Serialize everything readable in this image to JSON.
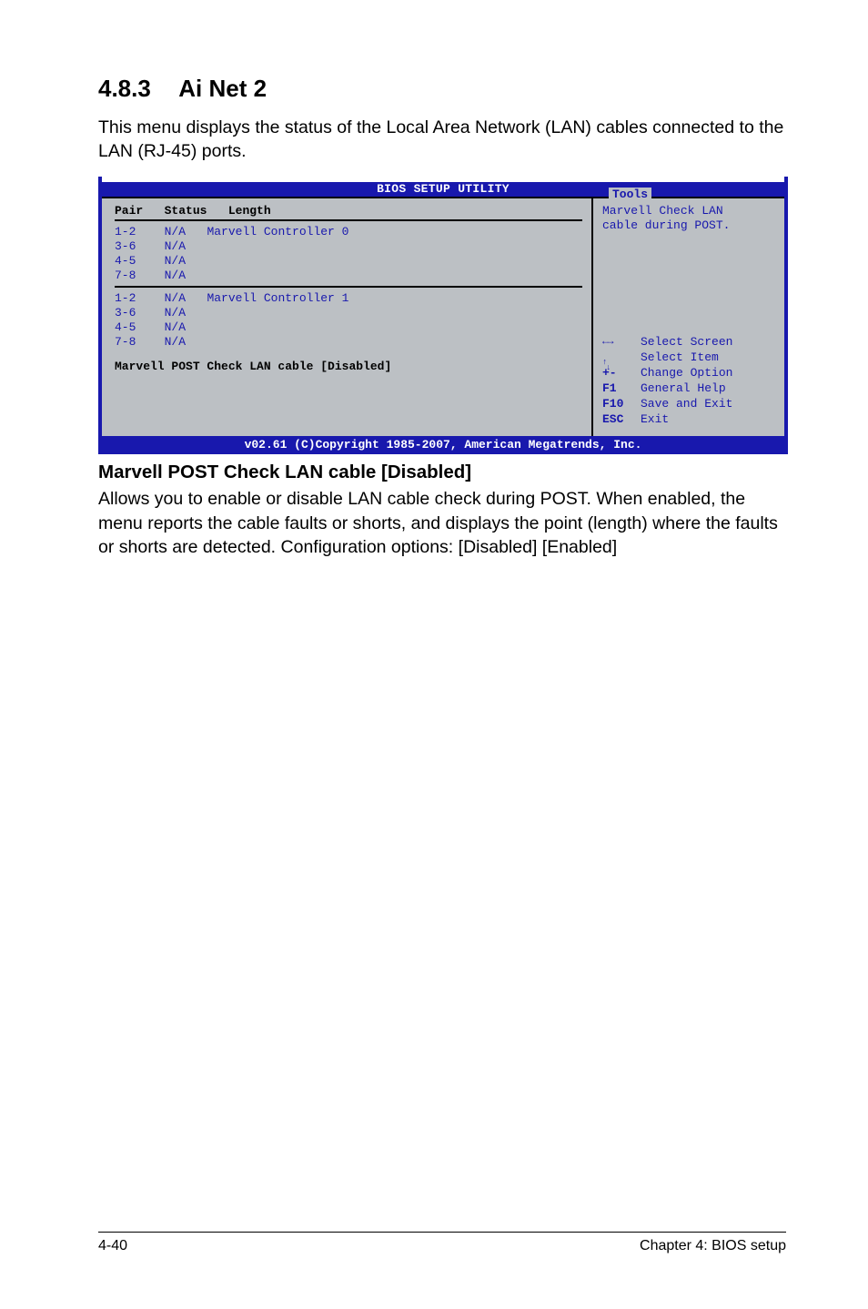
{
  "section": {
    "number": "4.8.3",
    "title": "Ai Net 2"
  },
  "intro": "This menu displays the status of the Local Area Network (LAN) cables connected to the LAN (RJ-45) ports.",
  "bios": {
    "banner": "BIOS SETUP UTILITY",
    "tab": "Tools",
    "header": {
      "pair": "Pair",
      "status": "Status",
      "length": "Length"
    },
    "ctrl0": {
      "name": "Marvell Controller 0",
      "rows": [
        {
          "pair": "1-2",
          "status": "N/A"
        },
        {
          "pair": "3-6",
          "status": "N/A"
        },
        {
          "pair": "4-5",
          "status": "N/A"
        },
        {
          "pair": "7-8",
          "status": "N/A"
        }
      ]
    },
    "ctrl1": {
      "name": "Marvell Controller 1",
      "rows": [
        {
          "pair": "1-2",
          "status": "N/A"
        },
        {
          "pair": "3-6",
          "status": "N/A"
        },
        {
          "pair": "4-5",
          "status": "N/A"
        },
        {
          "pair": "7-8",
          "status": "N/A"
        }
      ]
    },
    "setting": {
      "label": "Marvell POST Check LAN cable",
      "value": "[Disabled]"
    },
    "help": {
      "line1": "Marvell Check LAN",
      "line2": "cable during POST."
    },
    "hints": {
      "select_screen": "Select Screen",
      "select_item": "Select Item",
      "pm_key": "+-",
      "pm_txt": "Change Option",
      "f1_key": "F1",
      "f1_txt": "General Help",
      "f10_key": "F10",
      "f10_txt": "Save and Exit",
      "esc_key": "ESC",
      "esc_txt": "Exit"
    },
    "footer": "v02.61 (C)Copyright 1985-2007, American Megatrends, Inc."
  },
  "subhead": "Marvell POST Check LAN cable [Disabled]",
  "subbody": "Allows you to enable or disable LAN cable check during POST. When enabled, the menu reports the cable faults or shorts, and displays the point (length) where the faults or shorts are detected. Configuration options: [Disabled] [Enabled]",
  "footer": {
    "left": "4-40",
    "right": "Chapter 4: BIOS setup"
  }
}
